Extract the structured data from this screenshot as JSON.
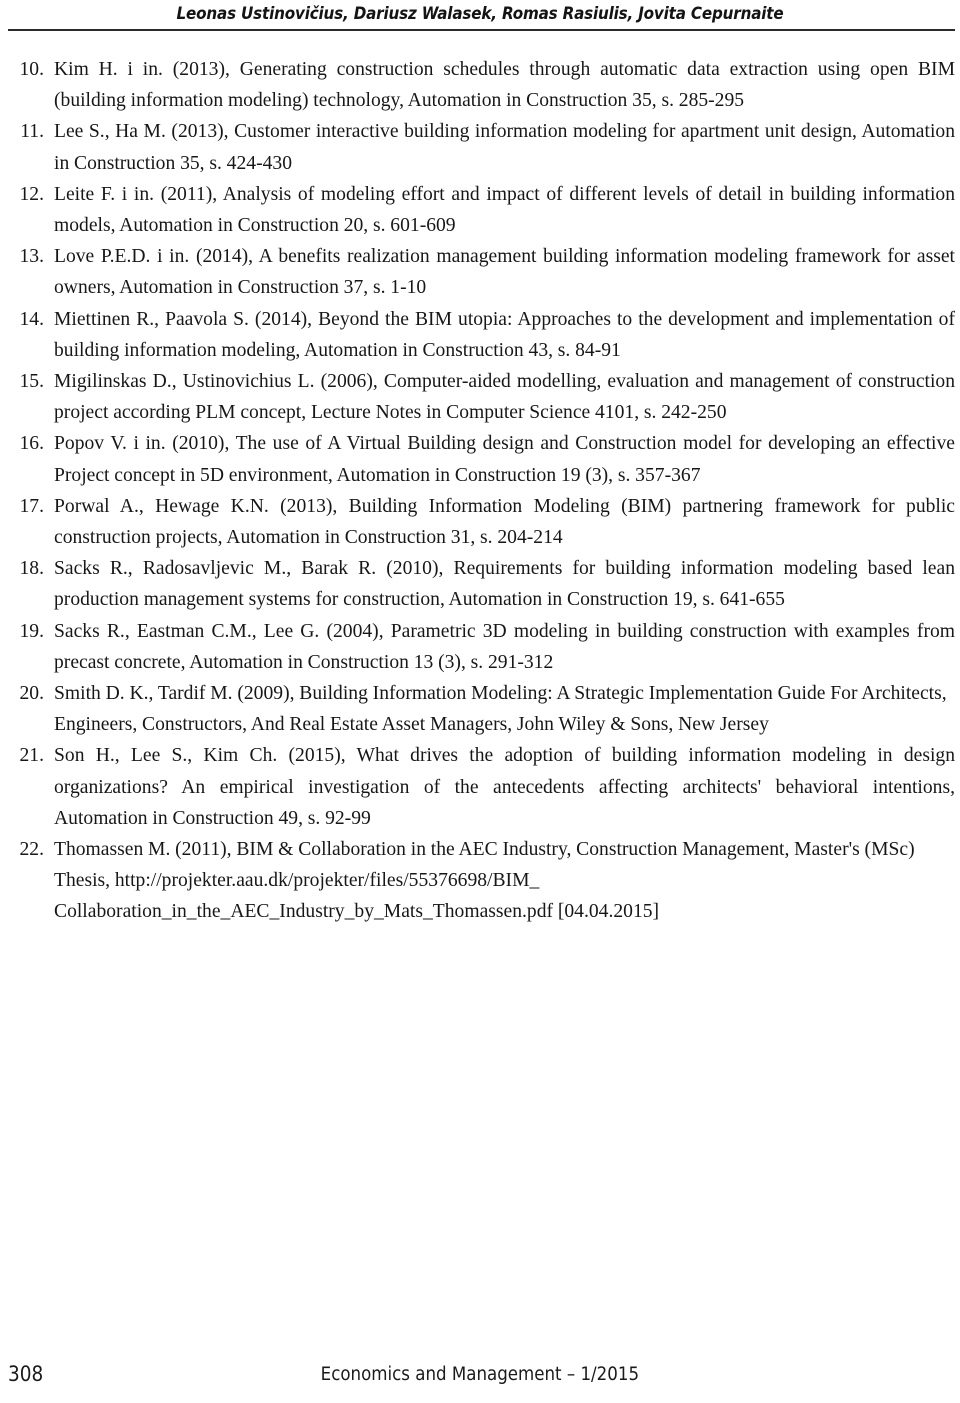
{
  "header": {
    "authors": "Leonas Ustinovičius, Dariusz Walasek, Romas Rasiulis, Jovita Cepurnaite"
  },
  "references": [
    {
      "number": "10.",
      "text": "Kim H. i in. (2013), Generating construction schedules through automatic data extrac­tion using open BIM (building information modeling) technology, Automation in Con­struction 35, s. 285-295"
    },
    {
      "number": "11.",
      "text": "Lee S., Ha M. (2013), Customer interactive building information modeling for apart­ment unit design, Automation in Construction 35, s. 424-430"
    },
    {
      "number": "12.",
      "text": "Leite F. i in. (2011), Analysis of modeling effort and impact of different levels of detail in building information models, Automation in Construction 20, s. 601-609"
    },
    {
      "number": "13.",
      "text": "Love P.E.D. i in. (2014), A benefits realization management building information mod­eling framework for asset owners, Automation in Construction 37, s. 1-10"
    },
    {
      "number": "14.",
      "text": "Miettinen R., Paavola S. (2014), Beyond the BIM utopia: Approaches to the development and implementation of building information modeling, Automation in Construction 43, s. 84-91"
    },
    {
      "number": "15.",
      "text": "Migilinskas D., Ustinovichius L. (2006), Computer-aided modelling, evaluation and management of construction project according PLM concept, Lecture Notes in Com­puter Science 4101, s. 242-250"
    },
    {
      "number": "16.",
      "text": "Popov V. i in. (2010), The use of A Virtual Building design and Construction model for developing an effective Project concept in 5D environment, Automation in Construction 19 (3), s. 357-367"
    },
    {
      "number": "17.",
      "text": "Porwal A., Hewage K.N. (2013), Building Information Modeling (BIM) partnering framework for public construction projects, Automation in Construction 31, s. 204-214"
    },
    {
      "number": "18.",
      "text": "Sacks R., Radosavljevic M., Barak R. (2010), Requirements for building information modeling based lean production management systems for construction, Automation in Construction 19, s. 641-655"
    },
    {
      "number": "19.",
      "text": "Sacks R., Eastman C.M., Lee G. (2004), Parametric 3D modeling in building construc­tion with examples from precast concrete, Automation in Construction 13 (3), s. 291-312"
    },
    {
      "number": "20.",
      "text": "Smith D. K., Tardif M. (2009), Building Information Modeling: A Strategic Implemen­tation Guide For Architects, Engineers, Constructors, And Real Estate Asset Managers, John Wiley & Sons, New Jersey"
    },
    {
      "number": "21.",
      "text": "Son H., Lee S., Kim Ch. (2015), What drives the adoption of building information mod­eling in design organizations? An empirical investigation of the antecedents affecting architects' behavioral intentions, Automation in Construction 49, s. 92-99"
    },
    {
      "number": "22.",
      "text": "Thomassen M. (2011), BIM & Collaboration in the AEC Industry, Construction Man­agement, Master's (MSc) Thesis, http://projekter.aau.dk/projekter/files/55376698/BIM_ Collaboration_in_the_AEC_Industry_by_Mats_Thomassen.pdf [04.04.2015]"
    }
  ],
  "footer": {
    "page_number": "308",
    "journal": "Economics and Management – 1/2015"
  }
}
